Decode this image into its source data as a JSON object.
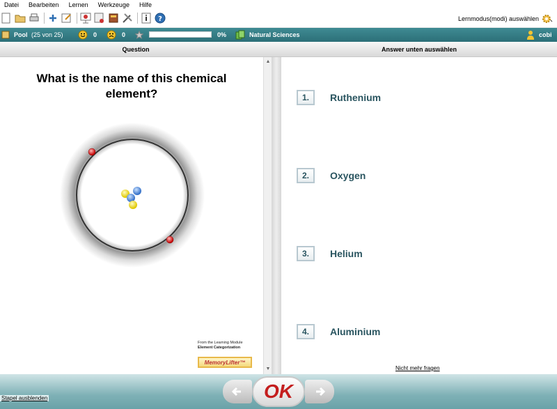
{
  "menu": [
    "Datei",
    "Bearbeiten",
    "Lernen",
    "Werkzeuge",
    "Hilfe"
  ],
  "toolbar": {
    "icons": [
      "new-icon",
      "open-icon",
      "print-icon",
      "add-icon",
      "edit-icon",
      "statistics-icon",
      "card-icon",
      "book-icon",
      "tools-icon",
      "info-icon",
      "help-icon"
    ],
    "mode_label": "Lernmodus(modi) auswählen"
  },
  "status": {
    "pool_label": "Pool",
    "pool_count": "(25 von 25)",
    "happy_count": "0",
    "sad_count": "0",
    "progress": 0,
    "progress_text": "0%",
    "category": "Natural Sciences",
    "user": "cobi"
  },
  "headers": {
    "question": "Question",
    "answer": "Answer unten auswählen"
  },
  "question": {
    "text": "What is the name of this chemical element?",
    "credit_line1": "From the Learning Module",
    "credit_line2": "Element Categorization",
    "logo": "MemoryLifter™"
  },
  "answers": [
    {
      "number": "1.",
      "label": "Ruthenium"
    },
    {
      "number": "2.",
      "label": "Oxygen"
    },
    {
      "number": "3.",
      "label": "Helium"
    },
    {
      "number": "4.",
      "label": "Aluminium"
    }
  ],
  "nomore_label": "Nicht mehr fragen",
  "bottom": {
    "hide_stack": "Stapel ausblenden",
    "ok_label": "OK"
  },
  "colors": {
    "teal": "#2c6f78",
    "answer_text": "#2a5560",
    "ok_red": "#c41e1e"
  }
}
